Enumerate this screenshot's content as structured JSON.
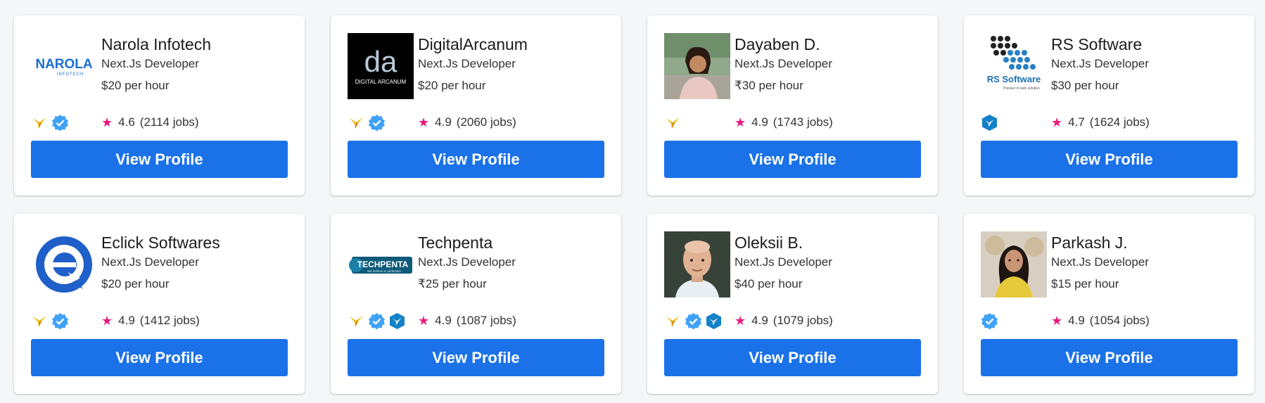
{
  "cards": [
    {
      "name": "Narola Infotech",
      "role": "Next.Js Developer",
      "rate": "$20 per hour",
      "rating": "4.6",
      "jobs": "(2114 jobs)",
      "button": "View Profile",
      "logo_text": "NAROLA",
      "logo_sub": "INFOTECH",
      "badges": [
        "hummingbird-icon",
        "verified-icon"
      ]
    },
    {
      "name": "DigitalArcanum",
      "role": "Next.Js Developer",
      "rate": "$20 per hour",
      "rating": "4.9",
      "jobs": "(2060 jobs)",
      "button": "View Profile",
      "logo_text": "da",
      "logo_sub": "DIGITAL ARCANUM",
      "badges": [
        "hummingbird-icon",
        "verified-icon"
      ]
    },
    {
      "name": "Dayaben D.",
      "role": "Next.Js Developer",
      "rate": "₹30 per hour",
      "rating": "4.9",
      "jobs": "(1743 jobs)",
      "button": "View Profile",
      "badges": [
        "hummingbird-icon"
      ]
    },
    {
      "name": "RS Software",
      "role": "Next.Js Developer",
      "rate": "$30 per hour",
      "rating": "4.7",
      "jobs": "(1624 jobs)",
      "button": "View Profile",
      "logo_text": "RS Software",
      "logo_sub": "Pioneer in web solution",
      "badges": [
        "hummingbird-shield-icon"
      ]
    },
    {
      "name": "Eclick Softwares",
      "role": "Next.Js Developer",
      "rate": "$20 per hour",
      "rating": "4.9",
      "jobs": "(1412 jobs)",
      "button": "View Profile",
      "badges": [
        "hummingbird-icon",
        "verified-icon"
      ]
    },
    {
      "name": "Techpenta",
      "role": "Next.Js Developer",
      "rate": "₹25 per hour",
      "rating": "4.9",
      "jobs": "(1087 jobs)",
      "button": "View Profile",
      "logo_text": "TECHPENTA",
      "logo_sub": "We believe in perfection",
      "badges": [
        "hummingbird-icon",
        "verified-icon",
        "hummingbird-shield-icon"
      ]
    },
    {
      "name": "Oleksii B.",
      "role": "Next.Js Developer",
      "rate": "$40 per hour",
      "rating": "4.9",
      "jobs": "(1079 jobs)",
      "button": "View Profile",
      "badges": [
        "hummingbird-icon",
        "verified-icon",
        "hummingbird-shield-icon"
      ]
    },
    {
      "name": "Parkash J.",
      "role": "Next.Js Developer",
      "rate": "$15 per hour",
      "rating": "4.9",
      "jobs": "(1054 jobs)",
      "button": "View Profile",
      "badges": [
        "verified-icon"
      ]
    }
  ],
  "colors": {
    "button": "#1b72e8",
    "star": "#e6197e",
    "verified": "#3fa2f7",
    "hummingbird": "#f2b705",
    "shield": "#1281c9"
  }
}
